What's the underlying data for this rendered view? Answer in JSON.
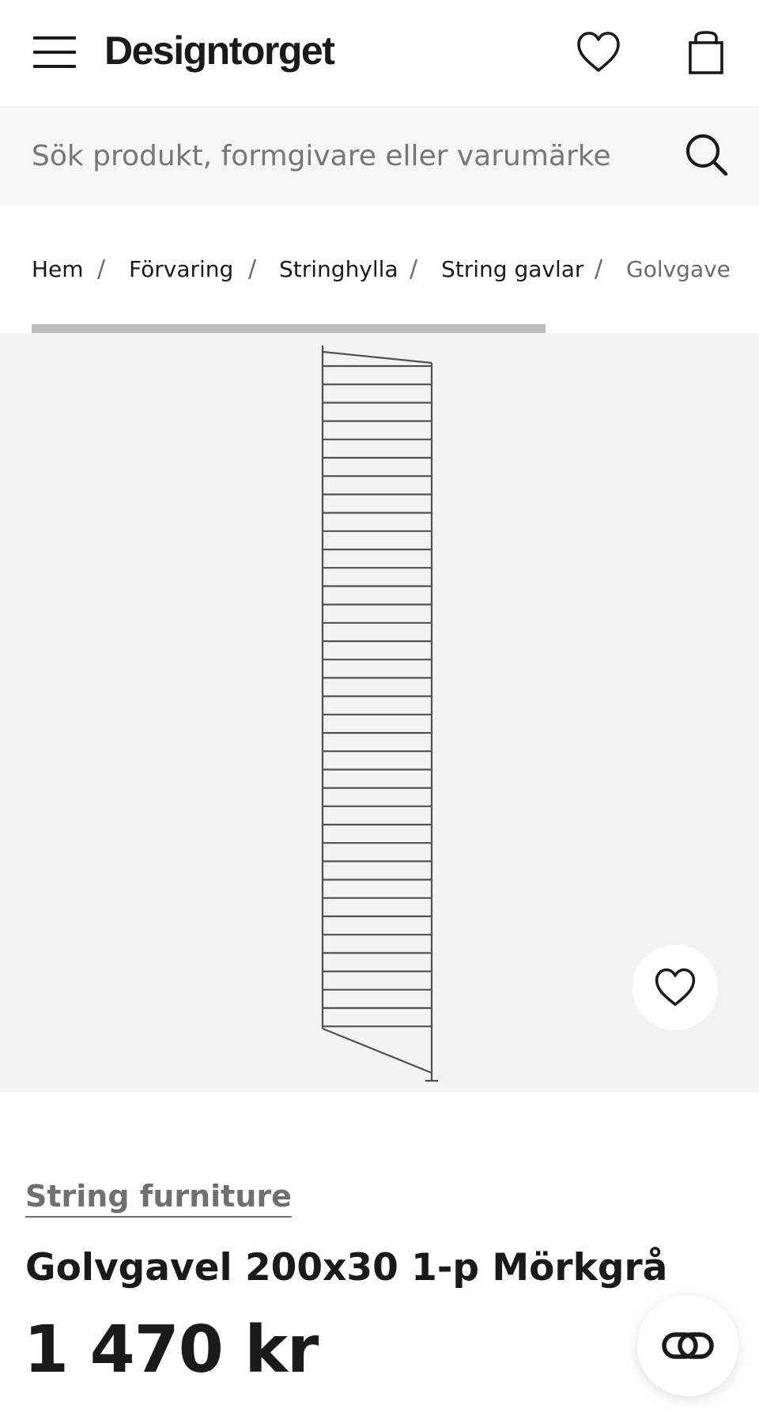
{
  "header": {
    "logo_text": "Designtorget",
    "menu_icon": "hamburger-menu-icon",
    "wishlist_icon": "heart-icon",
    "cart_icon": "shopping-bag-icon"
  },
  "search": {
    "placeholder": "Sök produkt, formgivare eller varumärke",
    "value": "",
    "icon": "search-icon"
  },
  "breadcrumb": {
    "items": [
      "Hem",
      "Förvaring",
      "Stringhylla",
      "String gavlar",
      "Golvgave"
    ],
    "separator": "/"
  },
  "gallery": {
    "image_alt_icon": "string-floor-panel-image",
    "wishlist_icon": "heart-icon"
  },
  "product": {
    "brand": "String furniture",
    "title": "Golvgavel 200x30 1-p Mörkgrå",
    "price": "1 470 kr"
  },
  "chat": {
    "icon": "chat-link-icon"
  },
  "colors": {
    "background": "#ffffff",
    "search_bg": "#f6f6f6",
    "image_bg": "#f3f3f3",
    "text": "#1a1a1a",
    "muted": "#707070",
    "scroll_indicator": "#bdbdbd"
  }
}
